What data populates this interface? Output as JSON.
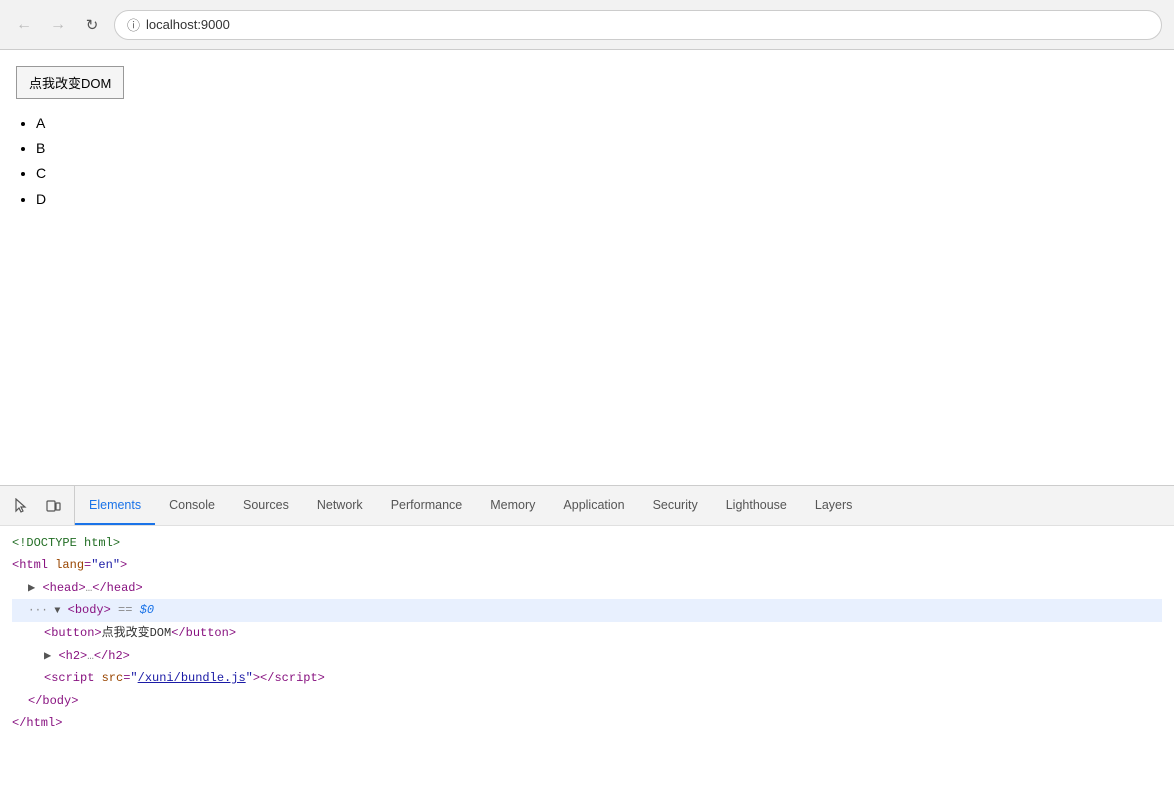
{
  "browser": {
    "back_disabled": true,
    "forward_disabled": true,
    "url": "localhost:9000",
    "info_icon": "ⓘ"
  },
  "page": {
    "button_label": "点我改变DOM",
    "list_items": [
      "A",
      "B",
      "C",
      "D"
    ]
  },
  "devtools": {
    "tabs": [
      {
        "id": "elements",
        "label": "Elements",
        "active": true
      },
      {
        "id": "console",
        "label": "Console",
        "active": false
      },
      {
        "id": "sources",
        "label": "Sources",
        "active": false
      },
      {
        "id": "network",
        "label": "Network",
        "active": false
      },
      {
        "id": "performance",
        "label": "Performance",
        "active": false
      },
      {
        "id": "memory",
        "label": "Memory",
        "active": false
      },
      {
        "id": "application",
        "label": "Application",
        "active": false
      },
      {
        "id": "security",
        "label": "Security",
        "active": false
      },
      {
        "id": "lighthouse",
        "label": "Lighthouse",
        "active": false
      },
      {
        "id": "layers",
        "label": "Layers",
        "active": false
      }
    ],
    "dom": {
      "doctype": "<!DOCTYPE html>",
      "html_open": "<html lang=\"en\">",
      "head": "<head>…</head>",
      "body_open": "<body>",
      "body_selected": "== $0",
      "button_tag": "<button>点我改变DOM</button>",
      "h2_tag": "<h2>…</h2>",
      "script_tag": "<script src=\"/xuni/bundle.js\"></script>",
      "body_close": "</body>",
      "html_close": "</html>"
    }
  }
}
